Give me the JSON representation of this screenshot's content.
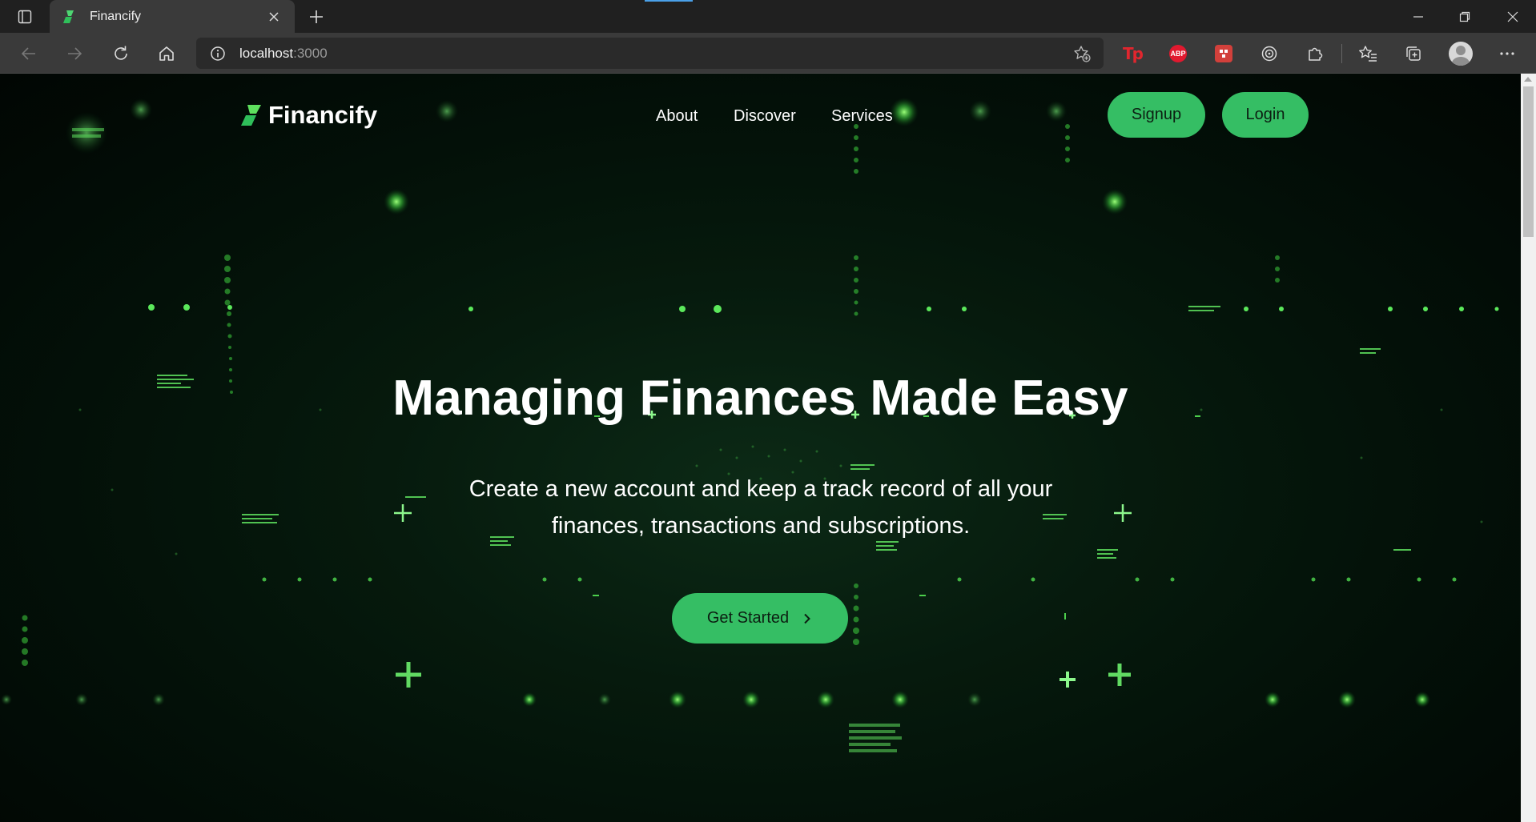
{
  "browser": {
    "tab_title": "Financify",
    "url_host": "localhost",
    "url_port": ":3000",
    "extensions": {
      "tp_label": "Tp",
      "abp_label": "ABP"
    }
  },
  "site": {
    "brand": "Financify",
    "nav": {
      "about": "About",
      "discover": "Discover",
      "services": "Services"
    },
    "auth": {
      "signup": "Signup",
      "login": "Login"
    }
  },
  "hero": {
    "title": "Managing Finances Made Easy",
    "subtitle": "Create a new account and keep a track record of all your finances, transactions and subscriptions.",
    "cta": "Get Started"
  },
  "colors": {
    "accent": "#35be64",
    "background": "#031008"
  }
}
